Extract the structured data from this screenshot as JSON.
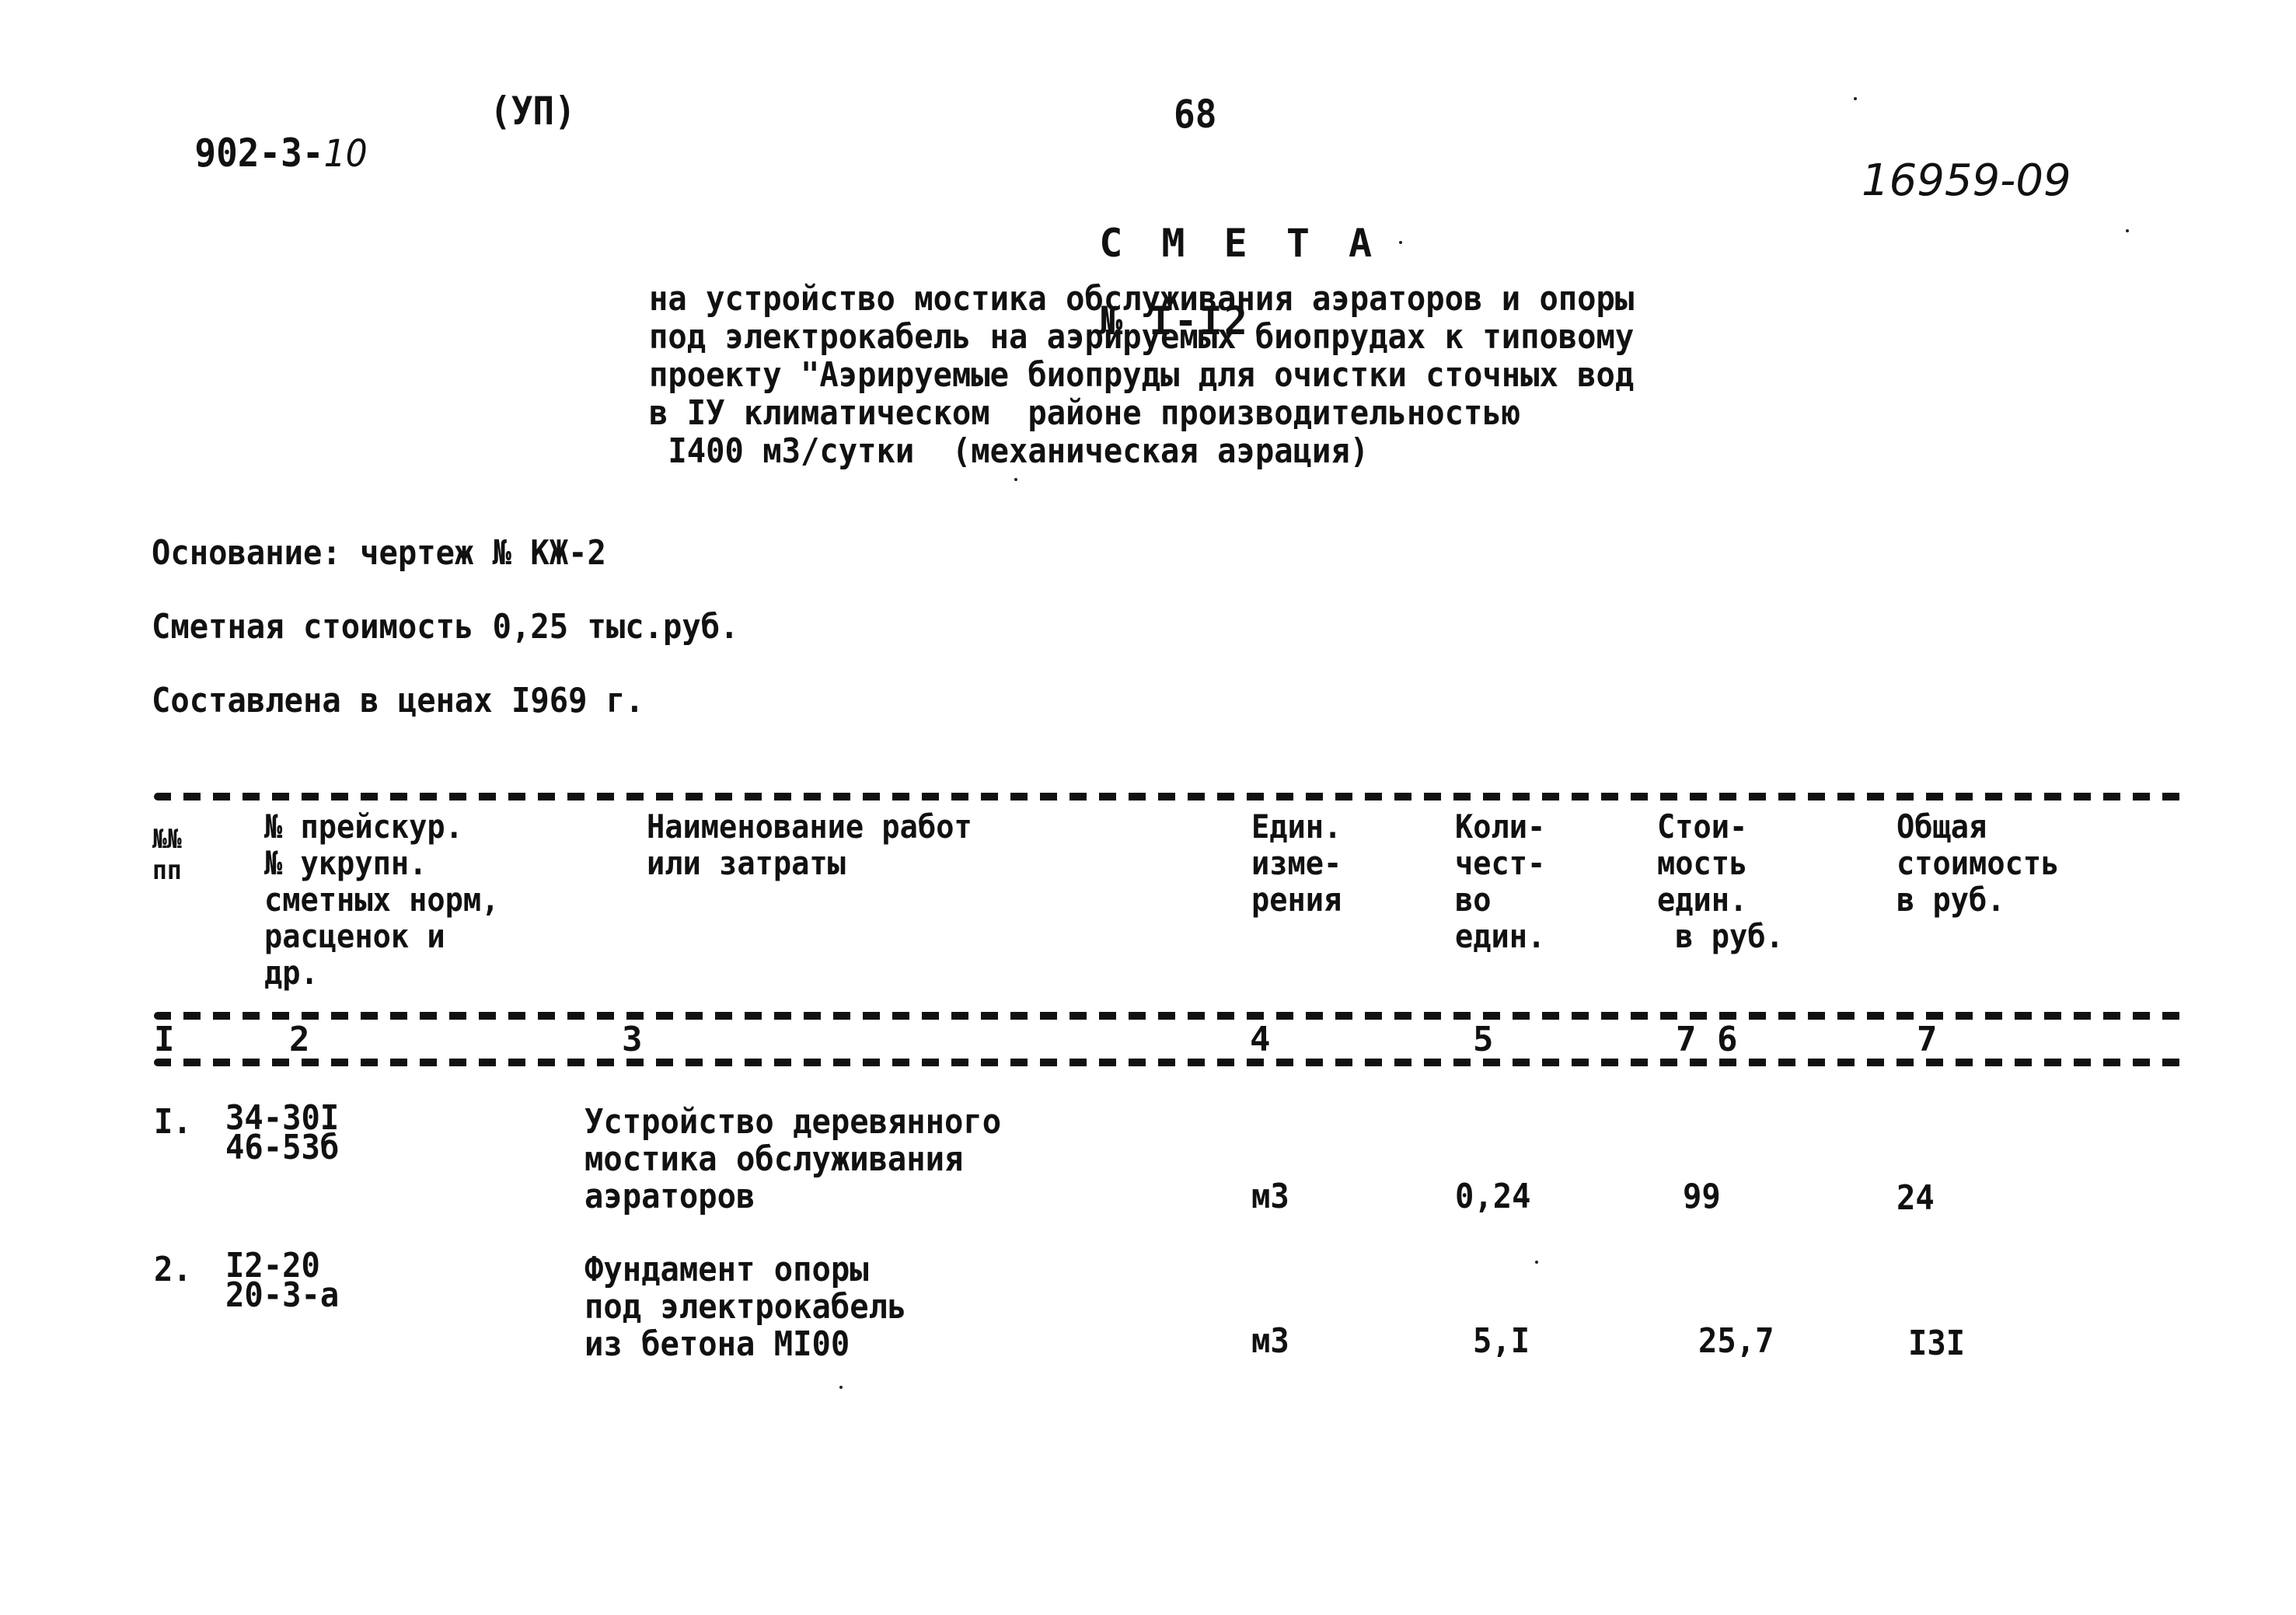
{
  "header": {
    "doc_code_prefix": "902-3-",
    "doc_code_suffix": "10",
    "album": "(УП)",
    "page_number": "68",
    "inventory_number": "16959-09"
  },
  "title": {
    "label": "С М Е Т А",
    "number": "№ I-I2"
  },
  "description_lines": [
    "на устройство мостика обслуживания аэраторов и опоры",
    "под электрокабель на аэрируемых биопрудах к типовому",
    "проекту \"Аэрируемые биопруды для очистки сточных вод",
    "в IУ климатическом  районе производительностью",
    " I400 м3/сутки  (механическая аэрация)"
  ],
  "info": {
    "basis": "Основание: чертеж № КЖ-2",
    "estimated_cost": "Сметная стоимость 0,25 тыс.руб.",
    "prices_year": "Составлена в ценах I969 г."
  },
  "table": {
    "headers": [
      [
        "№№",
        "пп"
      ],
      [
        "№ прейскур.",
        "№ укрупн.",
        "сметных норм,",
        "расценок и",
        "др."
      ],
      [
        "Наименование работ",
        "или затраты"
      ],
      [
        "Един.",
        "изме-",
        "рения"
      ],
      [
        "Коли-",
        "чест-",
        "во",
        "един."
      ],
      [
        "Стои-",
        "мость",
        "един.",
        " в руб."
      ],
      [
        "Общая",
        "стоимость",
        "в руб."
      ]
    ],
    "column_numbers": [
      "I",
      "2",
      "3",
      "4",
      "5",
      "7 6",
      "7"
    ],
    "rows": [
      {
        "num": "I.",
        "codes": [
          "34-30I",
          "46-53б"
        ],
        "name": [
          "Устройство деревянного",
          "мостика обслуживания",
          "аэраторов"
        ],
        "unit": "м3",
        "quantity": "0,24",
        "unit_cost": "99",
        "total_cost": "24"
      },
      {
        "num": "2.",
        "codes": [
          "I2-20",
          "20-3-а"
        ],
        "name": [
          "Фундамент опоры",
          "под электрокабель",
          "из бетона МI00"
        ],
        "unit": "м3",
        "quantity": "5,I",
        "unit_cost": "25,7",
        "total_cost": "I3I"
      }
    ]
  }
}
